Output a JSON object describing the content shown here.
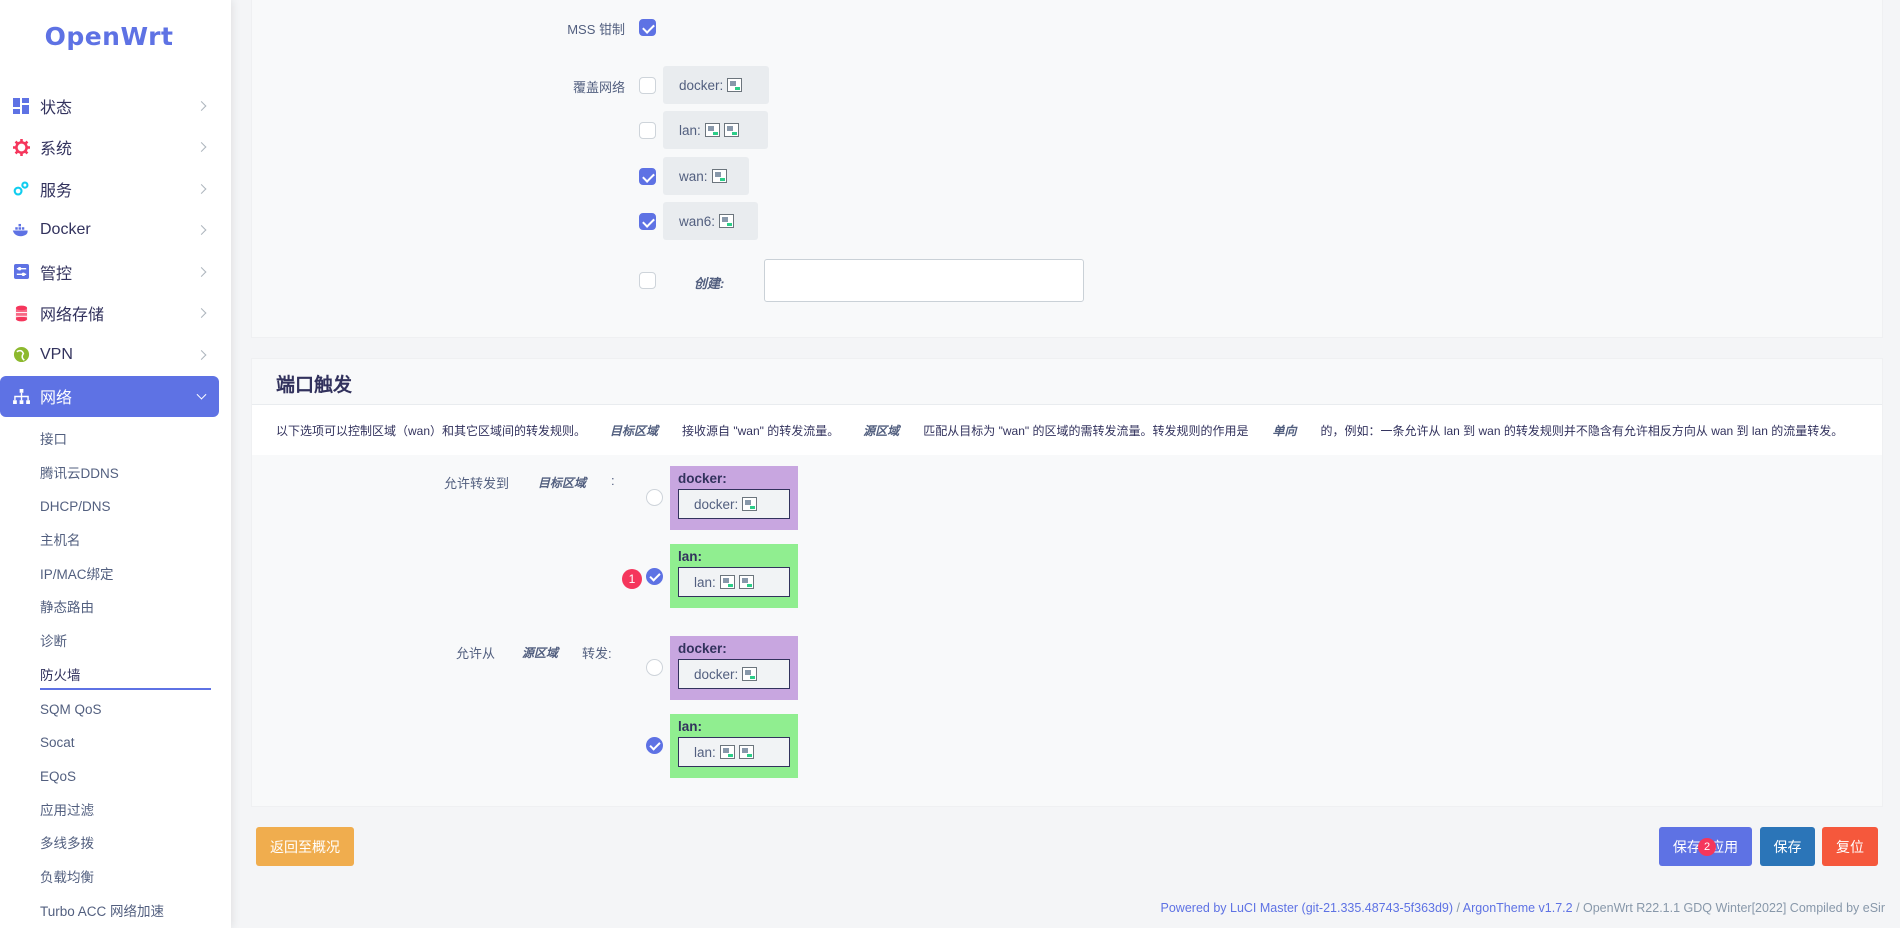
{
  "brand": {
    "logo_text": "OpenWrt"
  },
  "sidebar": {
    "items": [
      {
        "label": "状态",
        "icon": "dashboard-icon",
        "color": "#5e72e4"
      },
      {
        "label": "系统",
        "icon": "gear-icon",
        "color": "#f5365c"
      },
      {
        "label": "服务",
        "icon": "services-icon",
        "color": "#11cdef"
      },
      {
        "label": "Docker",
        "icon": "docker-icon",
        "color": "#5e72e4"
      },
      {
        "label": "管控",
        "icon": "sliders-icon",
        "color": "#5e72e4"
      },
      {
        "label": "网络存储",
        "icon": "database-icon",
        "color": "#f5365c"
      },
      {
        "label": "VPN",
        "icon": "globe-icon",
        "color": "#8db92e"
      },
      {
        "label": "网络",
        "icon": "network-icon",
        "active": true
      }
    ],
    "submenu": [
      "接口",
      "腾讯云DDNS",
      "DHCP/DNS",
      "主机名",
      "IP/MAC绑定",
      "静态路由",
      "诊断",
      "防火墙",
      "SQM QoS",
      "Socat",
      "EQoS",
      "应用过滤",
      "多线多拨",
      "负载均衡",
      "Turbo ACC 网络加速"
    ],
    "current_sub": "防火墙"
  },
  "general": {
    "mss_label": "MSS 钳制",
    "mss_checked": true,
    "covered_label": "覆盖网络",
    "networks": [
      {
        "label": "wan6:",
        "checked": true
      }
    ],
    "create_label": "创建:",
    "create_value": ""
  },
  "port_trigger": {
    "title": "端口触发",
    "desc_parts": [
      "以下选项可以控制区域（wan）和其它区域间的转发规则。",
      "目标区域",
      "接收源自 \"wan\" 的转发流量。",
      "源区域",
      "匹配从目标为 \"wan\" 的区域的需转发流量。转发规则的作用是",
      "单向",
      "的，例如：一条允许从 lan 到 wan 的转发规则并不隐含有允许相反方向从 wan 到 lan 的流量转发。"
    ],
    "forward_to": {
      "label_a": "允许转发到",
      "label_b": "目标区域",
      "label_c": ":",
      "zones": [
        {
          "name": "docker:",
          "inner": "docker:",
          "checked": false
        },
        {
          "name": "lan:",
          "inner": "lan:",
          "checked": true
        }
      ]
    },
    "forward_from": {
      "label_a": "允许从",
      "label_b": "源区域",
      "label_c": "转发:",
      "zones": [
        {
          "name": "docker:",
          "inner": "docker:",
          "checked": false
        },
        {
          "name": "lan:",
          "inner": "lan:",
          "checked": true
        }
      ]
    },
    "badge_1": "1"
  },
  "buttons": {
    "back": "返回至概况",
    "save_apply": "保存&应用",
    "save": "保存",
    "reset": "复位",
    "badge_2": "2"
  },
  "footer": {
    "powered": "Powered by LuCI Master (git-21.335.48743-5f363d9)",
    "sep": " / ",
    "theme": "ArgonTheme v1.7.2",
    "rest": " / OpenWrt R22.1.1 GDQ Winter[2022] Compiled by eSir"
  },
  "colors": {
    "accent": "#5e72e4",
    "zone_docker": "#c8a6e0",
    "zone_lan": "#90ee90",
    "back_button": "#f0ad4e",
    "save_button": "#2b75b8",
    "reset_button": "#f5583c",
    "badge": "#f5365c"
  }
}
